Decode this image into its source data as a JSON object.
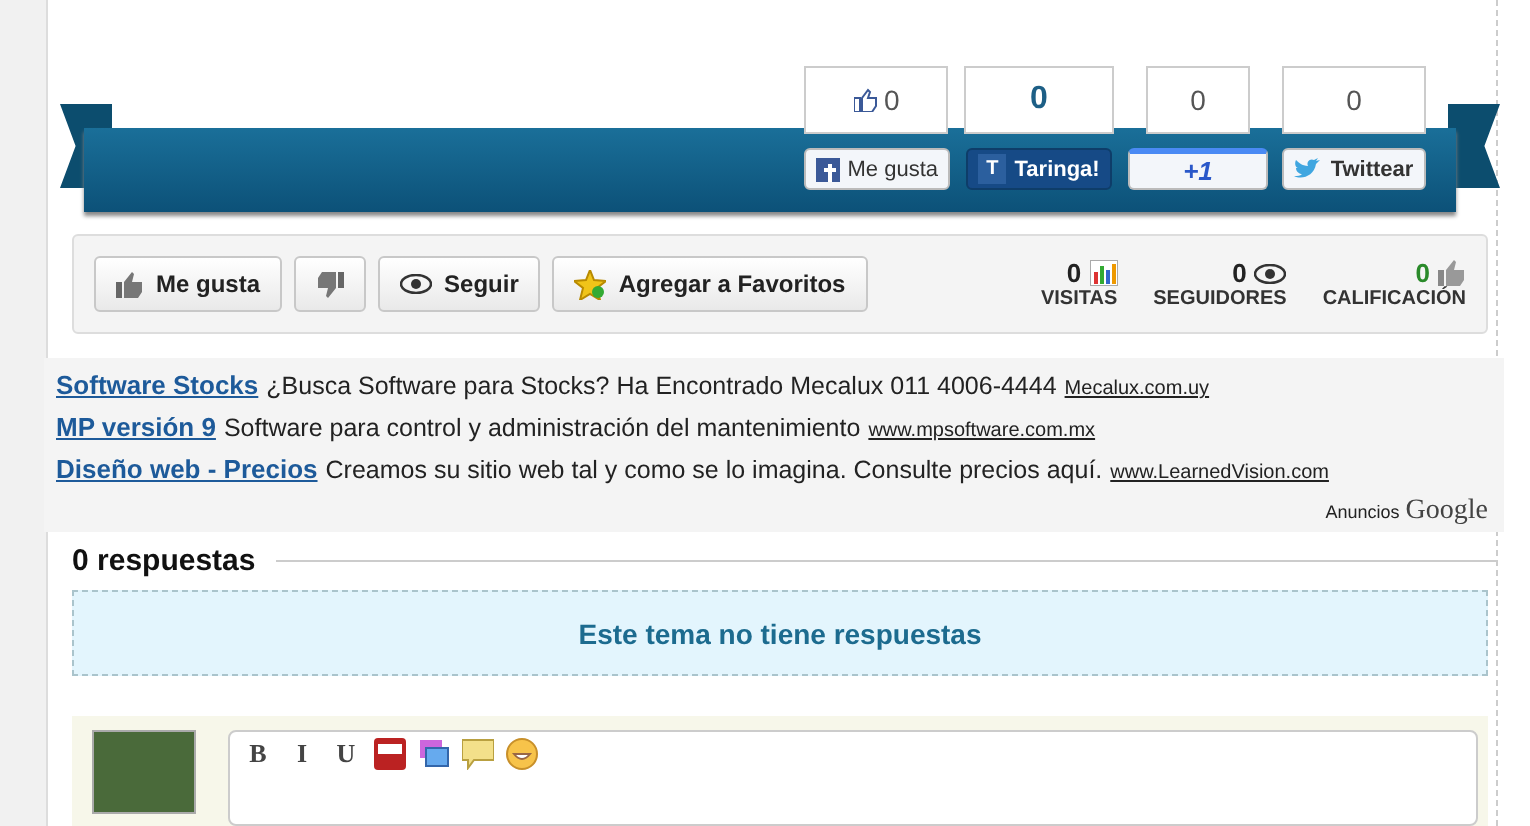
{
  "share": [
    {
      "kind": "facebook",
      "count": "0",
      "label": "Me gusta"
    },
    {
      "kind": "taringa",
      "count": "0",
      "label": "Taringa!",
      "badge": "T"
    },
    {
      "kind": "google",
      "count": "0",
      "label": "+1"
    },
    {
      "kind": "twitter",
      "count": "0",
      "label": "Twittear"
    }
  ],
  "actions": [
    {
      "kind": "like",
      "label": "Me gusta"
    },
    {
      "kind": "dislike"
    },
    {
      "kind": "follow",
      "label": "Seguir"
    },
    {
      "kind": "favorite",
      "label": "Agregar a Favoritos"
    }
  ],
  "stats": [
    {
      "kind": "visits",
      "value": "0",
      "label": "VISITAS"
    },
    {
      "kind": "followers",
      "value": "0",
      "label": "SEGUIDORES"
    },
    {
      "kind": "rating",
      "value": "0",
      "label": "CALIFICACIÓN"
    }
  ],
  "ads": [
    {
      "title": "Software Stocks",
      "text": "¿Busca Software para Stocks? Ha Encontrado Mecalux 011 4006-4444",
      "url": "Mecalux.com.uy"
    },
    {
      "title": "MP versión 9",
      "text": "Software para control y administración del mantenimiento",
      "url": "www.mpsoftware.com.mx"
    },
    {
      "title": "Diseño web - Precios",
      "text": "Creamos su sitio web tal y como se lo imagina. Consulte precios aquí.",
      "url": "www.LearnedVision.com"
    }
  ],
  "ads_footer": {
    "label": "Anuncios",
    "brand": "Google"
  },
  "replies": {
    "heading": "0 respuestas",
    "empty": "Este tema no tiene respuestas"
  },
  "editor": {
    "tools": [
      {
        "kind": "text",
        "label": "B"
      },
      {
        "kind": "text",
        "label": "I"
      },
      {
        "kind": "text",
        "label": "U"
      },
      {
        "kind": "video"
      },
      {
        "kind": "image"
      },
      {
        "kind": "quote"
      },
      {
        "kind": "emoji"
      }
    ]
  }
}
